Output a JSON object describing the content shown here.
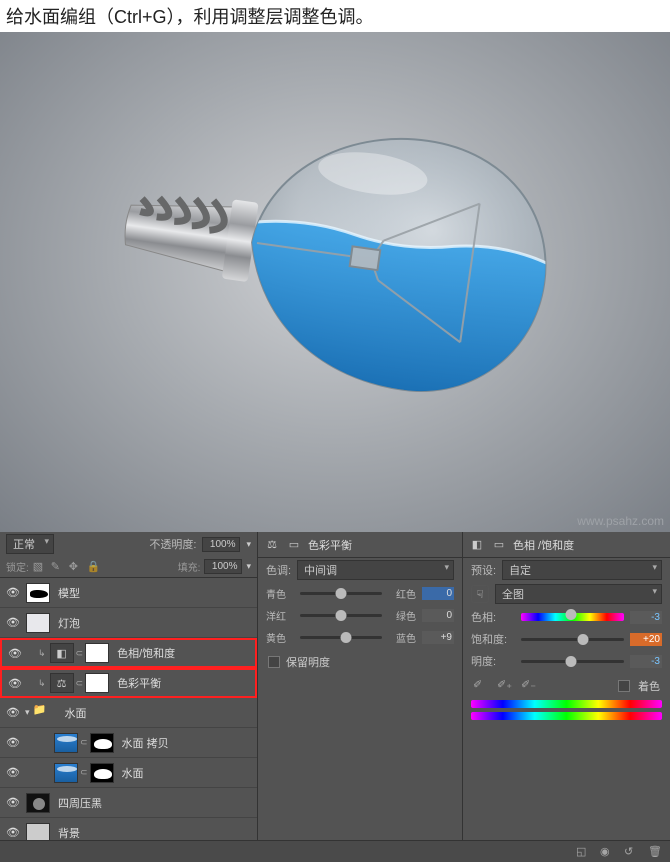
{
  "instruction": "给水面编组（Ctrl+G），利用调整层调整色调。",
  "watermark": "www.psahz.com",
  "layers_panel": {
    "blend_mode": "正常",
    "opacity_label": "不透明度:",
    "opacity_value": "100%",
    "lock_label": "锁定:",
    "fill_label": "填充:",
    "fill_value": "100%",
    "layers": [
      {
        "name": "模型"
      },
      {
        "name": "灯泡"
      },
      {
        "name": "色相/饱和度"
      },
      {
        "name": "色彩平衡"
      },
      {
        "name": "水面"
      },
      {
        "name": "水面 拷贝"
      },
      {
        "name": "水面"
      },
      {
        "name": "四周压黑"
      },
      {
        "name": "背景"
      }
    ]
  },
  "color_balance": {
    "title": "色彩平衡",
    "tone_label": "色调:",
    "tone_value": "中间调",
    "sliders": [
      {
        "left": "青色",
        "right": "红色",
        "value": "0",
        "pos": 50
      },
      {
        "left": "洋红",
        "right": "绿色",
        "value": "0",
        "pos": 50
      },
      {
        "left": "黄色",
        "right": "蓝色",
        "value": "+9",
        "pos": 56
      }
    ],
    "preserve_label": "保留明度"
  },
  "hue_sat": {
    "title": "色相 /饱和度",
    "preset_label": "预设:",
    "preset_value": "自定",
    "range_value": "全图",
    "sliders": [
      {
        "label": "色相:",
        "value": "-3",
        "pos": 49,
        "neg": true
      },
      {
        "label": "饱和度:",
        "value": "+20",
        "pos": 60,
        "hot": true
      },
      {
        "label": "明度:",
        "value": "-3",
        "pos": 49,
        "neg": true
      }
    ],
    "colorize_label": "着色"
  }
}
